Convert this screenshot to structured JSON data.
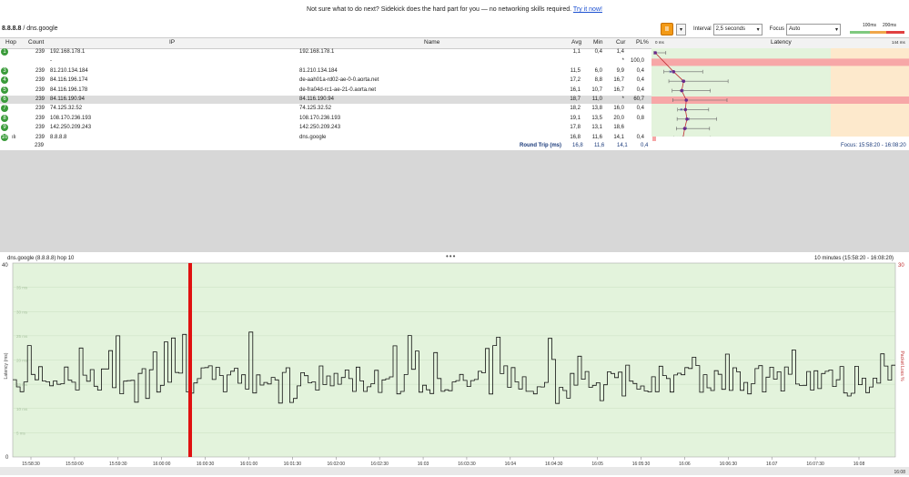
{
  "banner": {
    "text": "Not sure what to do next? Sidekick does the hard part for you — no networking skills required.",
    "link": "Try it now!"
  },
  "target": {
    "ip": "8.8.8.8",
    "sep": " / ",
    "name": "dns.google"
  },
  "controls": {
    "pause_icon": "pause-icon",
    "interval_label": "Interval",
    "interval_value": "2,5 seconds",
    "focus_label": "Focus",
    "focus_value": "Auto",
    "legend_100": "100ms",
    "legend_200": "200ms",
    "colors": {
      "green": "#7fc97f",
      "orange": "#f0a64a",
      "red": "#e04040"
    }
  },
  "table": {
    "headers": {
      "hop": "Hop",
      "count": "Count",
      "ip": "IP",
      "name": "Name",
      "avg": "Avg",
      "min": "Min",
      "cur": "Cur",
      "pl": "PL%",
      "lat0": "0 ms",
      "latency": "Latency",
      "latmax": "144 ms"
    },
    "rows": [
      {
        "hop": "1",
        "count": "239",
        "ip": "192.168.178.1",
        "name": "192.168.178.1",
        "avg": "1,1",
        "min": "0,4",
        "cur": "1,4",
        "pl": ""
      },
      {
        "hop": "",
        "count": "",
        "ip": "-",
        "name": "",
        "avg": "",
        "min": "",
        "cur": "*",
        "pl": "100,0"
      },
      {
        "hop": "3",
        "count": "239",
        "ip": "81.210.134.184",
        "name": "81.210.134.184",
        "avg": "11,5",
        "min": "6,0",
        "cur": "9,9",
        "pl": "0,4"
      },
      {
        "hop": "4",
        "count": "239",
        "ip": "84.116.196.174",
        "name": "de-aah01a-rd02-ae-0-0.aorta.net",
        "avg": "17,2",
        "min": "8,8",
        "cur": "16,7",
        "pl": "0,4"
      },
      {
        "hop": "5",
        "count": "239",
        "ip": "84.116.196.178",
        "name": "de-fra04d-rc1-ae-21-0.aorta.net",
        "avg": "16,1",
        "min": "10,7",
        "cur": "16,7",
        "pl": "0,4"
      },
      {
        "hop": "6",
        "count": "239",
        "ip": "84.116.190.94",
        "name": "84.116.190.94",
        "avg": "18,7",
        "min": "11,0",
        "cur": "*",
        "pl": "60,7"
      },
      {
        "hop": "7",
        "count": "239",
        "ip": "74.125.32.52",
        "name": "74.125.32.52",
        "avg": "18,2",
        "min": "13,8",
        "cur": "16,0",
        "pl": "0,4"
      },
      {
        "hop": "8",
        "count": "239",
        "ip": "108.170.236.193",
        "name": "108.170.236.193",
        "avg": "19,1",
        "min": "13,5",
        "cur": "20,0",
        "pl": "0,8"
      },
      {
        "hop": "9",
        "count": "239",
        "ip": "142.250.209.243",
        "name": "142.250.209.243",
        "avg": "17,8",
        "min": "13,1",
        "cur": "18,6",
        "pl": ""
      },
      {
        "hop": "10",
        "count": "239",
        "ip": "8.8.8.8",
        "name": "dns.google",
        "avg": "16,8",
        "min": "11,6",
        "cur": "14,1",
        "pl": "0,4"
      }
    ],
    "roundtrip": {
      "count": "239",
      "label": "Round Trip (ms)",
      "avg": "16,8",
      "min": "11,6",
      "cur": "14,1",
      "pl": "0,4",
      "focus": "Focus: 15:58:20 - 16:08:20"
    }
  },
  "graph": {
    "title": "dns.google (8.8.8.8) hop 10",
    "range": "10 minutes (15:58:20 - 16:08:20)",
    "ylabel": "Latency (ms)",
    "ylabel_right": "Packet Loss %",
    "y_top": "40",
    "y_bottom": "0",
    "y_right_top": "30",
    "gridlabels": [
      "35 ms",
      "30 ms",
      "25 ms",
      "20 ms",
      "15 ms",
      "10 ms",
      "5 ms"
    ],
    "xticks": [
      "15:58:30",
      "15:59:00",
      "15:59:30",
      "16:00:00",
      "16:00:30",
      "16:01:00",
      "16:01:30",
      "16:02:00",
      "16:02:30",
      "16:03",
      "16:03:30",
      "16:04",
      "16:04:30",
      "16:05",
      "16:05:30",
      "16:06",
      "16:06:30",
      "16:07",
      "16:07:30",
      "16:08"
    ],
    "clock": "16:08"
  }
}
